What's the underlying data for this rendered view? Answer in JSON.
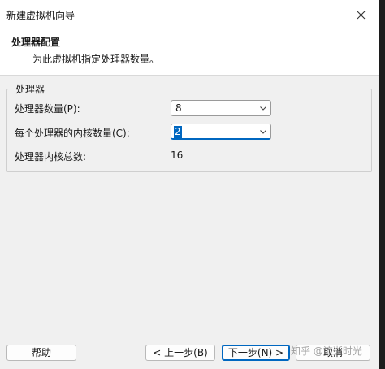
{
  "window": {
    "title": "新建虚拟机向导"
  },
  "header": {
    "title": "处理器配置",
    "subtitle": "为此虚拟机指定处理器数量。"
  },
  "processors_group": {
    "legend": "处理器",
    "processor_count": {
      "label": "处理器数量(P):",
      "value": "8"
    },
    "cores_per_processor": {
      "label": "每个处理器的内核数量(C):",
      "value": "2"
    },
    "total_cores": {
      "label": "处理器内核总数:",
      "value": "16"
    }
  },
  "footer": {
    "help_label": "帮助",
    "back_label": "< 上一步(B)",
    "next_label": "下一步(N) >",
    "cancel_label": "取消",
    "watermark": "知乎 @流逝时光"
  },
  "colors": {
    "accent": "#0067c0",
    "dialog_bg": "#f0f0f0",
    "header_bg": "#ffffff",
    "outside_bg": "#1c1c1c"
  }
}
